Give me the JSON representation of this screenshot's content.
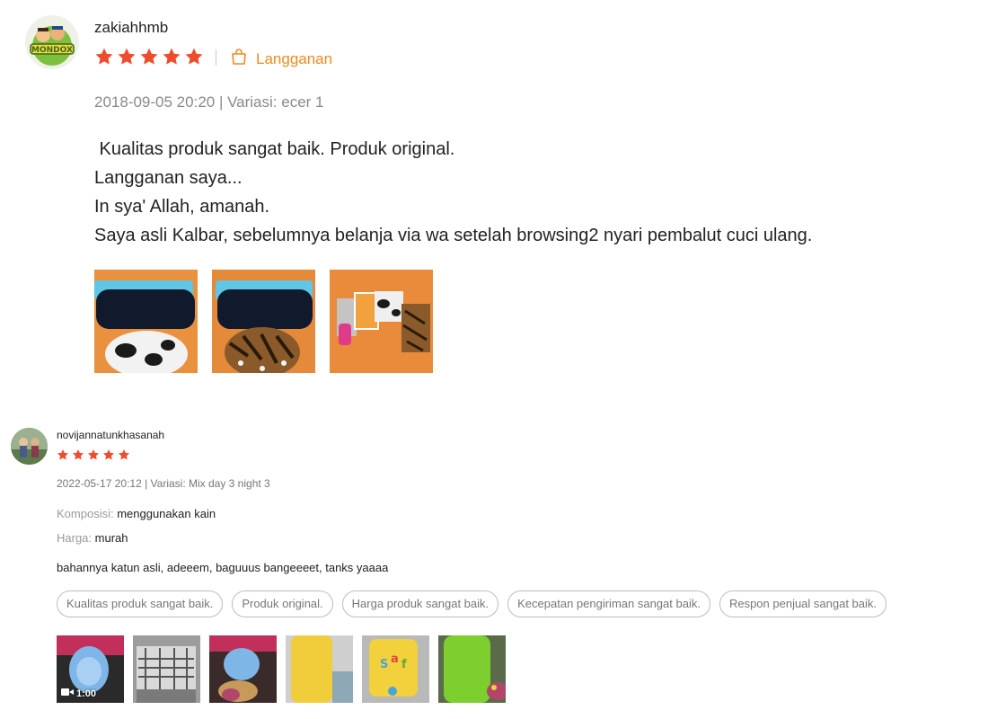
{
  "reviews": [
    {
      "username": "zakiahhmb",
      "avatar_icon": "mondox-logo-avatar",
      "rating": 5,
      "subscription_label": "Langganan",
      "meta": "2018-09-05 20:20 | Variasi: ecer 1",
      "text_lines": [
        " Kualitas produk sangat baik. Produk original.",
        "Langganan saya...",
        "In sya' Allah, amanah.",
        "Saya asli Kalbar, sebelumnya belanja via wa setelah browsing2 nyari pembalut cuci ulang."
      ],
      "images": [
        "photo-pads-cow-print",
        "photo-pads-tiger-print",
        "photo-product-packages"
      ]
    },
    {
      "username": "novijannatunkhasanah",
      "avatar_icon": "user-photo-avatar",
      "rating": 5,
      "meta": "2022-05-17 20:12 | Variasi: Mix day 3 night 3",
      "attributes": [
        {
          "label": "Komposisi:",
          "value": "menggunakan kain"
        },
        {
          "label": "Harga:",
          "value": "murah"
        }
      ],
      "comment": "bahannya katun asli, adeeem, baguuus bangeeeet, tanks yaaaa",
      "tags": [
        "Kualitas produk sangat baik.",
        "Produk original.",
        "Harga produk sangat baik.",
        "Kecepatan pengiriman sangat baik.",
        "Respon penjual sangat baik."
      ],
      "video_duration": "1:00",
      "media": [
        "video-pads-rolled",
        "photo-pads-package",
        "photo-pads-rolled",
        "photo-yellow-pad",
        "photo-yellow-pad-print",
        "photo-green-pad"
      ]
    }
  ],
  "colors": {
    "star": "#ee4d2d",
    "subscription": "#ee8a1e",
    "meta": "#8a8a8a",
    "tag_border": "#bdbdbd"
  }
}
